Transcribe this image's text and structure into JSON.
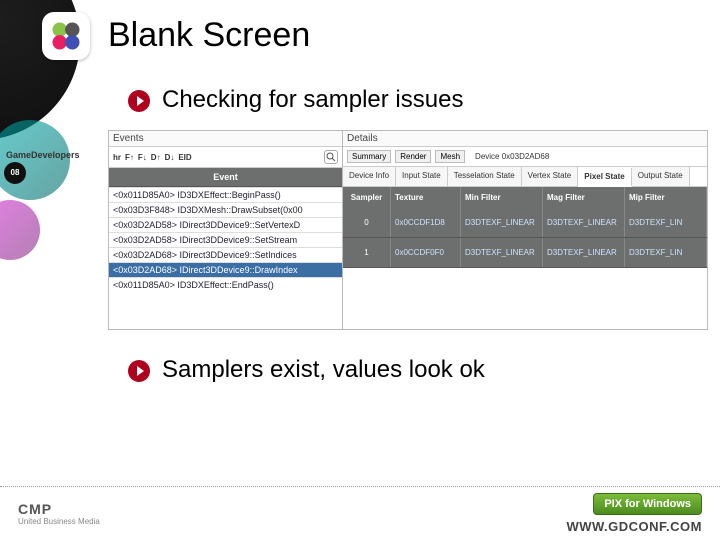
{
  "slide": {
    "title": "Blank Screen",
    "bullets": [
      "Checking for sampler issues",
      "Samplers exist, values look ok"
    ]
  },
  "events_pane": {
    "title": "Events",
    "toolbar": [
      "hr",
      "F↑",
      "F↓",
      "D↑",
      "D↓",
      "EID"
    ],
    "header": "Event",
    "rows": [
      "<0x011D85A0> ID3DXEffect::BeginPass()",
      "<0x03D3F848> ID3DXMesh::DrawSubset(0x00",
      "<0x03D2AD58> IDirect3DDevice9::SetVertexD",
      "<0x03D2AD58> IDirect3DDevice9::SetStream",
      "<0x03D2AD68> IDirect3DDevice9::SetIndices",
      "<0x03D2AD68> IDirect3DDevice9::DrawIndex",
      "<0x011D85A0> ID3DXEffect::EndPass()"
    ],
    "selected_index": 5
  },
  "details_pane": {
    "title": "Details",
    "tabs1": [
      "Summary",
      "Render",
      "Mesh"
    ],
    "device_label": "Device 0x03D2AD68",
    "tabs2": [
      "Device Info",
      "Input State",
      "Tesselation State",
      "Vertex State",
      "Pixel State",
      "Output State"
    ],
    "tabs2_active": 4,
    "sampler_table": {
      "columns": [
        "Sampler",
        "Texture",
        "Min Filter",
        "Mag Filter",
        "Mip Filter"
      ],
      "rows": [
        {
          "sampler": "0",
          "texture": "0x0CCDF1D8",
          "min": "D3DTEXF_LINEAR",
          "mag": "D3DTEXF_LINEAR",
          "mip": "D3DTEXF_LIN"
        },
        {
          "sampler": "1",
          "texture": "0x0CCDF0F0",
          "min": "D3DTEXF_LINEAR",
          "mag": "D3DTEXF_LINEAR",
          "mip": "D3DTEXF_LIN"
        }
      ]
    }
  },
  "branding": {
    "conf_line1": "GameDevelopers",
    "conf_badge": "08",
    "pix_badge": "PIX for Windows",
    "gdconf": "WWW.GDCONF.COM",
    "cmp_logo": "CMP",
    "cmp_sub": "United Business Media"
  }
}
